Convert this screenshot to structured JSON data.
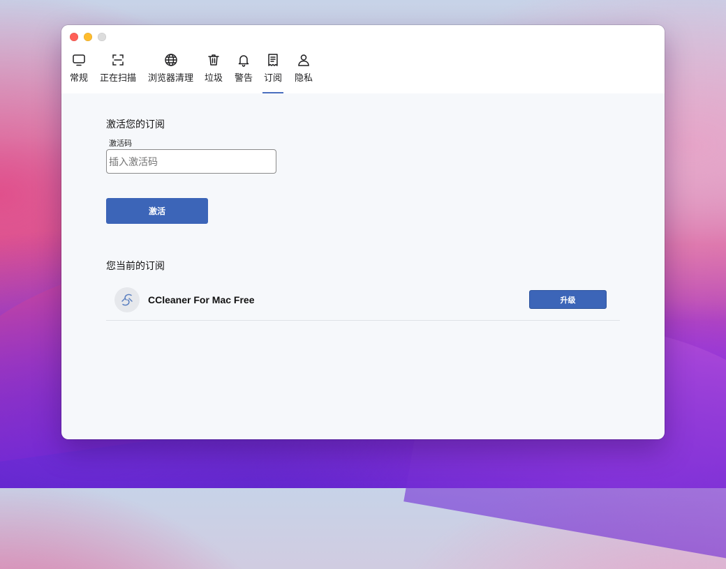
{
  "window": {
    "tabs": [
      {
        "label": "常规",
        "icon": "monitor-icon"
      },
      {
        "label": "正在扫描",
        "icon": "scan-frame-icon"
      },
      {
        "label": "浏览器清理",
        "icon": "globe-icon"
      },
      {
        "label": "垃圾",
        "icon": "trash-icon"
      },
      {
        "label": "警告",
        "icon": "bell-icon"
      },
      {
        "label": "订阅",
        "icon": "receipt-icon",
        "active": true
      },
      {
        "label": "隐私",
        "icon": "person-icon"
      }
    ]
  },
  "activation": {
    "heading": "激活您的订阅",
    "field_label": "激活码",
    "input_placeholder": "插入激活码",
    "input_value": "",
    "button_label": "激活"
  },
  "subscription": {
    "heading": "您当前的订阅",
    "product_name": "CCleaner For Mac Free",
    "upgrade_label": "升级"
  },
  "colors": {
    "accent": "#3c65b8",
    "tab_indicator": "#4a6fbf",
    "content_bg": "#f6f8fb"
  }
}
